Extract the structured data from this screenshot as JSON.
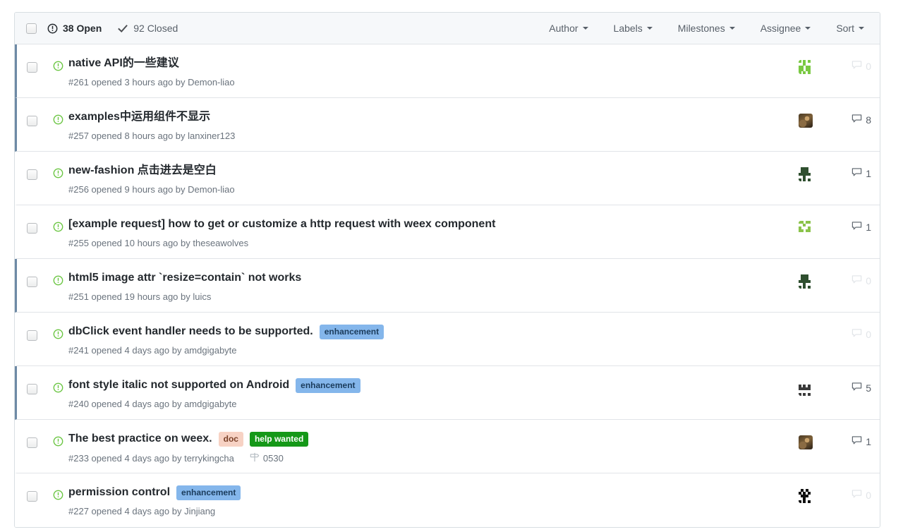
{
  "header": {
    "select_all_checkbox": "select-all",
    "states": [
      {
        "icon": "issue-opened-icon",
        "count": "38",
        "label": "Open",
        "text": "38 Open",
        "active": true
      },
      {
        "icon": "check-icon",
        "count": "92",
        "label": "Closed",
        "text": "92 Closed",
        "active": false
      }
    ],
    "filters": [
      {
        "label": "Author"
      },
      {
        "label": "Labels"
      },
      {
        "label": "Milestones"
      },
      {
        "label": "Assignee"
      },
      {
        "label": "Sort"
      }
    ]
  },
  "colors": {
    "header_bg": "#f6f8fa",
    "border": "#e1e4e8",
    "flag_border": "#6e8aa5",
    "open_icon": "#6cc644",
    "title": "#24292e",
    "meta": "#6a737d",
    "label_enhancement_bg": "#84b6eb",
    "label_enhancement_fg": "#1b3c5c",
    "label_doc_bg": "#f7d2c4",
    "label_doc_fg": "#7a4128",
    "label_help_wanted_bg": "#159818",
    "label_help_wanted_fg": "#ffffff"
  },
  "issues": [
    {
      "title": "native API的一些建议",
      "meta": "#261 opened 3 hours ago by Demon-liao",
      "number": "#261",
      "opened": "opened 3 hours ago",
      "author": "Demon-liao",
      "labels": [],
      "milestone": null,
      "comments": "0",
      "avatar": "green-identicon",
      "flagged": true,
      "state": "open"
    },
    {
      "title": "examples中运用组件不显示",
      "meta": "#257 opened 8 hours ago by lanxiner123",
      "number": "#257",
      "opened": "opened 8 hours ago",
      "author": "lanxiner123",
      "labels": [],
      "milestone": null,
      "comments": "8",
      "avatar": "photo-avatar",
      "flagged": true,
      "state": "open"
    },
    {
      "title": "new-fashion 点击进去是空白",
      "meta": "#256 opened 9 hours ago by Demon-liao",
      "number": "#256",
      "opened": "opened 9 hours ago",
      "author": "Demon-liao",
      "labels": [],
      "milestone": null,
      "comments": "1",
      "avatar": "dark-identicon",
      "flagged": false,
      "state": "open"
    },
    {
      "title": "[example request] how to get or customize a http request with weex component",
      "meta": "#255 opened 10 hours ago by theseawolves",
      "number": "#255",
      "opened": "opened 10 hours ago",
      "author": "theseawolves",
      "labels": [],
      "milestone": null,
      "comments": "1",
      "avatar": "green-identicon-2",
      "flagged": false,
      "state": "open"
    },
    {
      "title": "html5 image attr `resize=contain` not works",
      "meta": "#251 opened 19 hours ago by luics",
      "number": "#251",
      "opened": "opened 19 hours ago",
      "author": "luics",
      "labels": [],
      "milestone": null,
      "comments": "0",
      "avatar": "dark-identicon",
      "flagged": true,
      "state": "open"
    },
    {
      "title": "dbClick event handler needs to be supported.",
      "meta": "#241 opened 4 days ago by amdgigabyte",
      "number": "#241",
      "opened": "opened 4 days ago",
      "author": "amdgigabyte",
      "labels": [
        {
          "name": "enhancement",
          "style": "enhancement"
        }
      ],
      "milestone": null,
      "comments": "0",
      "avatar": null,
      "flagged": false,
      "state": "open"
    },
    {
      "title": "font style italic not supported on Android",
      "meta": "#240 opened 4 days ago by amdgigabyte",
      "number": "#240",
      "opened": "opened 4 days ago",
      "author": "amdgigabyte",
      "labels": [
        {
          "name": "enhancement",
          "style": "enhancement"
        }
      ],
      "milestone": null,
      "comments": "5",
      "avatar": "mono-identicon",
      "flagged": true,
      "state": "open"
    },
    {
      "title": "The best practice on weex.",
      "meta": "#233 opened 4 days ago by terrykingcha",
      "number": "#233",
      "opened": "opened 4 days ago",
      "author": "terrykingcha",
      "labels": [
        {
          "name": "doc",
          "style": "doc"
        },
        {
          "name": "help wanted",
          "style": "help-wanted"
        }
      ],
      "milestone": "0530",
      "comments": "1",
      "avatar": "photo-avatar",
      "flagged": false,
      "state": "open"
    },
    {
      "title": "permission control",
      "meta": "#227 opened 4 days ago by Jinjiang",
      "number": "#227",
      "opened": "opened 4 days ago",
      "author": "Jinjiang",
      "labels": [
        {
          "name": "enhancement",
          "style": "enhancement"
        }
      ],
      "milestone": null,
      "comments": "0",
      "avatar": "black-identicon",
      "flagged": false,
      "state": "open"
    }
  ]
}
